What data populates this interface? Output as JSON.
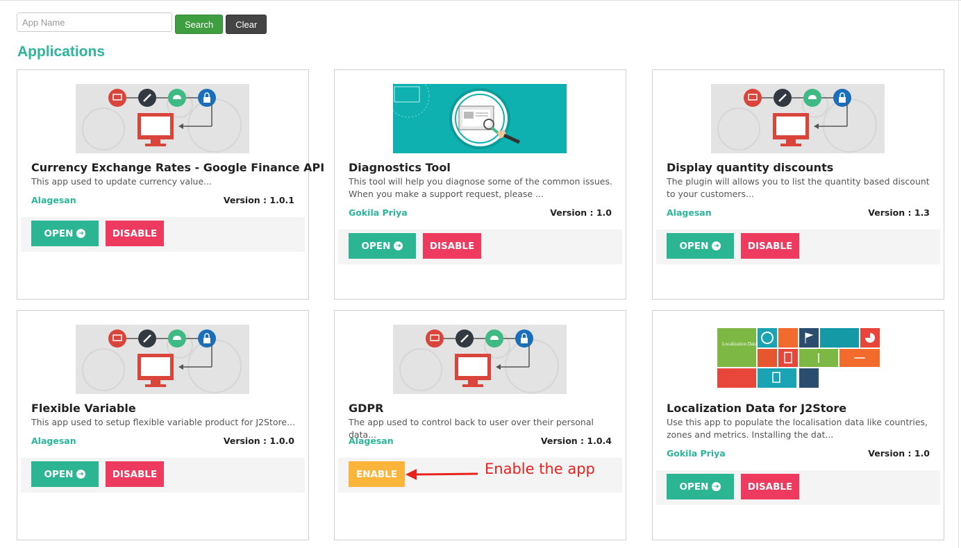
{
  "search": {
    "placeholder": "App Name",
    "value": "",
    "search_label": "Search",
    "clear_label": "Clear"
  },
  "heading": "Applications",
  "colors": {
    "accent": "#2bb59a",
    "open": "#2bb593",
    "disable": "#ee3a5e",
    "enable": "#fcb53b",
    "search": "#3f9e40",
    "clear": "#444444",
    "annotation": "#e8221e"
  },
  "apps": [
    {
      "title": "Currency Exchange Rates - Google Finance API",
      "desc": "This app used to update currency value...",
      "author": "Alagesan",
      "version": "Version : 1.0.1",
      "image": "generic-app-banner",
      "actions": [
        "open",
        "disable"
      ],
      "open_label": "OPEN",
      "disable_label": "DISABLE"
    },
    {
      "title": "Diagnostics Tool",
      "desc": "This tool will help you diagnose some of the common issues. When you make a support request, please ...",
      "author": "Gokila Priya",
      "version": "Version : 1.0",
      "image": "diagnostics-banner",
      "actions": [
        "open",
        "disable"
      ],
      "open_label": "OPEN",
      "disable_label": "DISABLE"
    },
    {
      "title": "Display quantity discounts",
      "desc": "The plugin will allows you to list the quantity based discount to your customers...",
      "author": "Alagesan",
      "version": "Version : 1.3",
      "image": "generic-app-banner",
      "actions": [
        "open",
        "disable"
      ],
      "open_label": "OPEN",
      "disable_label": "DISABLE"
    },
    {
      "title": "Flexible Variable",
      "desc": "This app used to setup flexible variable product for J2Store...",
      "author": "Alagesan",
      "version": "Version : 1.0.0",
      "image": "generic-app-banner",
      "actions": [
        "open",
        "disable"
      ],
      "open_label": "OPEN",
      "disable_label": "DISABLE"
    },
    {
      "title": "GDPR",
      "desc": "The app used to control back to user over their personal data...",
      "author": "Alagesan",
      "version": "Version : 1.0.4",
      "image": "generic-app-banner",
      "actions": [
        "enable"
      ],
      "enable_label": "ENABLE"
    },
    {
      "title": "Localization Data for J2Store",
      "desc": "Use this app to populate the localisation data like countries, zones and metrics. Installing the dat...",
      "author": "Gokila Priya",
      "version": "Version : 1.0",
      "image": "localization-banner",
      "image_text": "Localization Data",
      "actions": [
        "open",
        "disable"
      ],
      "open_label": "OPEN",
      "disable_label": "DISABLE"
    }
  ],
  "annotation": {
    "text": "Enable the app"
  }
}
